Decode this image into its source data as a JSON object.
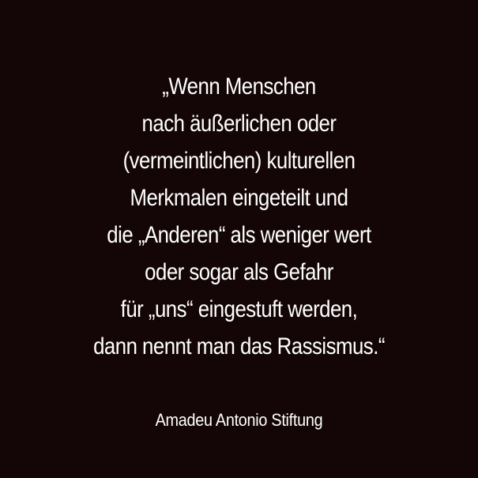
{
  "quote": {
    "lines": [
      "„Wenn Menschen",
      "nach äußerlichen oder",
      "(vermeintlichen) kulturellen",
      "Merkmalen eingeteilt und",
      "die „Anderen“ als weniger wert",
      "oder sogar als Gefahr",
      "für „uns“ eingestuft werden,",
      "dann nennt man das Rassismus.“"
    ]
  },
  "attribution": "Amadeu Antonio Stiftung",
  "colors": {
    "background": "#140606",
    "text": "#ffffff"
  }
}
